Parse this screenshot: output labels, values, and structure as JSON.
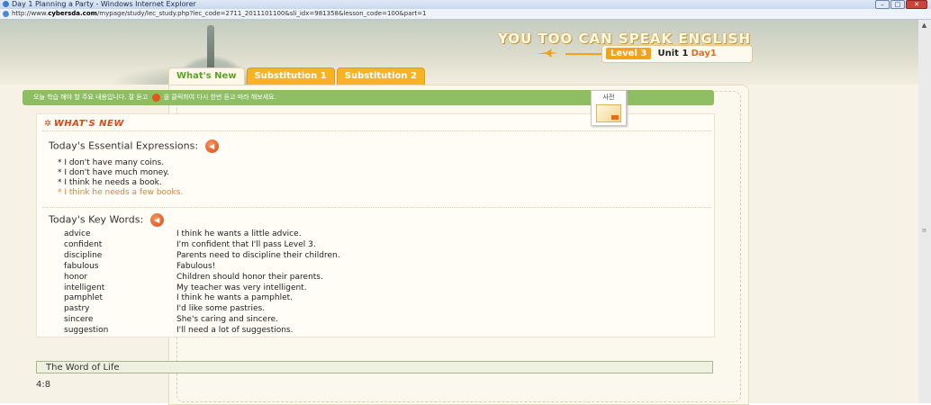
{
  "window": {
    "title": "Day 1 Planning a Party - Windows Internet Explorer",
    "controls": [
      "–",
      "□",
      "✕"
    ]
  },
  "address": {
    "prefix": "http://www.",
    "domain": "cybersda.com",
    "path": "/mypage/study/lec_study.php?lec_code=2711_2011101100&sli_idx=981358&lesson_code=100&part=1"
  },
  "banner": {
    "brand": "YOU TOO CAN SPEAK ENGLISH",
    "level": "Level 3",
    "unit": "Unit 1",
    "day": "Day1"
  },
  "tabs": [
    {
      "label": "What's New",
      "active": true
    },
    {
      "label": "Substitution 1",
      "active": false
    },
    {
      "label": "Substitution 2",
      "active": false
    }
  ],
  "instruction": {
    "before": "오늘 학습 해야 할 주요 내용입니다. 잘 듣고",
    "after": "을 클릭하여 다시 한번 듣고 따라 해보세요."
  },
  "dictionary": {
    "label": "사전"
  },
  "whats_new_title": "WHAT'S NEW",
  "expressions": {
    "heading": "Today's Essential Expressions:",
    "items": [
      "* I don't have many coins.",
      "* I don't have much money.",
      "* I think he needs a book.",
      "* I think he needs a few books."
    ]
  },
  "key_words": {
    "heading": "Today's Key Words:",
    "rows": [
      {
        "word": "advice",
        "sentence": "I think he wants a little advice."
      },
      {
        "word": "confident",
        "sentence": "I'm confident that I'll pass Level 3."
      },
      {
        "word": "discipline",
        "sentence": "Parents need to discipline their children."
      },
      {
        "word": "fabulous",
        "sentence": "Fabulous!"
      },
      {
        "word": "honor",
        "sentence": "Children should honor their parents."
      },
      {
        "word": "intelligent",
        "sentence": "My teacher was very intelligent."
      },
      {
        "word": "pamphlet",
        "sentence": "I think he wants a pamphlet."
      },
      {
        "word": "pastry",
        "sentence": "I'd like some pastries."
      },
      {
        "word": "sincere",
        "sentence": "She's caring and sincere."
      },
      {
        "word": "suggestion",
        "sentence": "I'll need a lot of suggestions."
      }
    ]
  },
  "word_of_life": {
    "heading": "The Word of Life",
    "verse": "4:8"
  },
  "colors": {
    "accent_orange": "#f6b325",
    "active_tab_text": "#5ba12a",
    "instruction_bar": "#8ebd63",
    "highlight_text": "#ec7b36",
    "title_red": "#d8481a"
  }
}
